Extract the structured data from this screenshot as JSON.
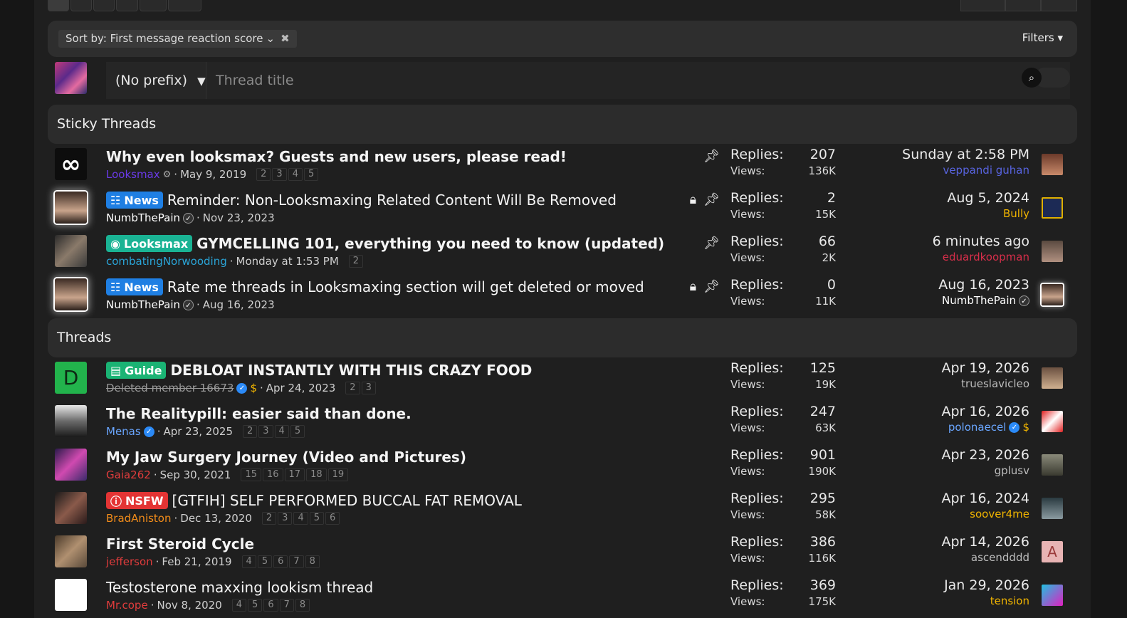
{
  "sort": {
    "label": "Sort by: First message reaction score"
  },
  "filters_label": "Filters",
  "new_thread": {
    "prefix": "(No prefix)",
    "placeholder": "Thread title"
  },
  "sections": {
    "sticky": "Sticky Threads",
    "threads": "Threads"
  },
  "labels": {
    "replies": "Replies:",
    "views": "Views:"
  },
  "sticky_threads": [
    {
      "title": "Why even looksmax? Guests and new users, please read!",
      "author": "Looksmax",
      "date": "May 9, 2019",
      "pages": [
        "2",
        "3",
        "4",
        "5"
      ],
      "replies": "207",
      "views": "136K",
      "last_date": "Sunday at 2:58 PM",
      "last_user": "veppandi guhan"
    },
    {
      "prefix": "News",
      "title": "Reminder: Non-Looksmaxing Related Content Will Be Removed",
      "author": "NumbThePain",
      "date": "Nov 23, 2023",
      "pages": [],
      "replies": "2",
      "views": "15K",
      "last_date": "Aug 5, 2024",
      "last_user": "Bully"
    },
    {
      "prefix": "Looksmax",
      "title": "GYMCELLING 101, everything you need to know (updated)",
      "author": "combatingNorwooding",
      "date": "Monday at 1:53 PM",
      "pages": [
        "2"
      ],
      "replies": "66",
      "views": "2K",
      "last_date": "6 minutes ago",
      "last_user": "eduardkoopman"
    },
    {
      "prefix": "News",
      "title": "Rate me threads in Looksmaxing section will get deleted or moved",
      "author": "NumbThePain",
      "date": "Aug 16, 2023",
      "pages": [],
      "replies": "0",
      "views": "11K",
      "last_date": "Aug 16, 2023",
      "last_user": "NumbThePain"
    }
  ],
  "threads": [
    {
      "prefix": "Guide",
      "title": "DEBLOAT INSTANTLY WITH THIS CRAZY FOOD",
      "author": "Deleted member 16673",
      "avatar_letter": "D",
      "date": "Apr 24, 2023",
      "pages": [
        "2",
        "3"
      ],
      "replies": "125",
      "views": "19K",
      "last_date": "Apr 19, 2026",
      "last_user": "trueslavicleo"
    },
    {
      "title": "The Realitypill: easier said than done.",
      "author": "Menas",
      "date": "Apr 23, 2025",
      "pages": [
        "2",
        "3",
        "4",
        "5"
      ],
      "replies": "247",
      "views": "63K",
      "last_date": "Apr 16, 2026",
      "last_user": "polonaecel"
    },
    {
      "title": "My Jaw Surgery Journey (Video and Pictures)",
      "author": "Gaia262",
      "date": "Sep 30, 2021",
      "pages": [
        "15",
        "16",
        "17",
        "18",
        "19"
      ],
      "replies": "901",
      "views": "190K",
      "last_date": "Apr 23, 2026",
      "last_user": "gplusv"
    },
    {
      "prefix": "NSFW",
      "title": "[GTFIH] SELF PERFORMED BUCCAL FAT REMOVAL",
      "author": "BradAniston",
      "date": "Dec 13, 2020",
      "pages": [
        "2",
        "3",
        "4",
        "5",
        "6"
      ],
      "replies": "295",
      "views": "58K",
      "last_date": "Apr 16, 2024",
      "last_user": "soover4me"
    },
    {
      "title": "First Steroid Cycle",
      "author": "jefferson",
      "date": "Feb 21, 2019",
      "pages": [
        "4",
        "5",
        "6",
        "7",
        "8"
      ],
      "replies": "386",
      "views": "116K",
      "last_date": "Apr 14, 2026",
      "last_user": "ascendddd",
      "last_avatar_letter": "A"
    },
    {
      "title": "Testosterone maxxing lookism thread",
      "author": "Mr.cope",
      "date": "Nov 8, 2020",
      "pages": [
        "4",
        "5",
        "6",
        "7",
        "8"
      ],
      "replies": "369",
      "views": "175K",
      "last_date": "Jan 29, 2026",
      "last_user": "tension"
    }
  ],
  "colors": {
    "background": "#161616",
    "panel": "#1f1f1f",
    "accent_blue": "#1f7fe3",
    "accent_green": "#1ab394",
    "nsfw_red": "#e33434"
  }
}
